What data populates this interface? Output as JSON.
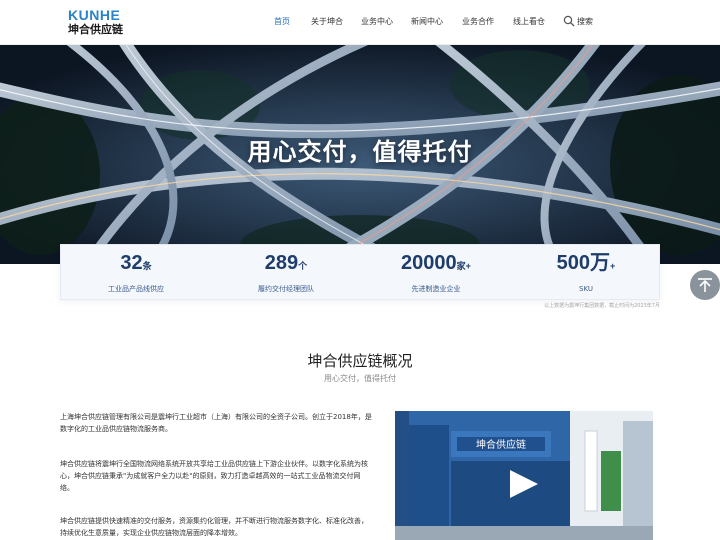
{
  "header": {
    "logo_en": "KUNHE",
    "logo_cn": "坤合供应链",
    "nav": [
      {
        "label": "首页",
        "active": true
      },
      {
        "label": "关于坤合"
      },
      {
        "label": "业务中心"
      },
      {
        "label": "新闻中心"
      },
      {
        "label": "业务合作"
      },
      {
        "label": "线上看仓"
      }
    ],
    "search_label": "搜索"
  },
  "hero": {
    "title": "用心交付，值得托付"
  },
  "stats": [
    {
      "value": "32",
      "unit": "条",
      "label": "工业品产品线供应"
    },
    {
      "value": "289",
      "unit": "个",
      "label": "履约交付经理团队"
    },
    {
      "value": "20000",
      "unit": "家+",
      "label": "先进制造业企业"
    },
    {
      "value": "500万",
      "unit": "+",
      "label": "SKU"
    }
  ],
  "source_note": "以上数据为震坤行集团数据，截止时间为2023年7月",
  "overview": {
    "title": "坤合供应链概况",
    "subtitle": "用心交付，值得托付",
    "paragraphs": [
      "上海坤合供应链管理有限公司是震坤行工业超市（上海）有限公司的全资子公司。创立于2018年，是数字化的工业品供应链物流服务商。",
      "坤合供应链将震坤行全国物流网络系统开放共享给工业品供应链上下游企业伙伴。以数字化系统为核心，坤合供应链秉承\"为成就客户全力以赴\"的原则，致力打造卓越高效的一站式工业品物流交付网络。",
      "坤合供应链提供快速精准的交付服务，资源集约化管理，并不断进行物流服务数字化、标准化改善，持续优化生意质量，实现企业供应链物流层面的降本增效。"
    ]
  },
  "video": {
    "sign_text": "坤合供应链"
  },
  "colors": {
    "accent": "#2a6fc6",
    "stat_number": "#1f3d6b",
    "hero_bg": "#0f1a2b"
  }
}
